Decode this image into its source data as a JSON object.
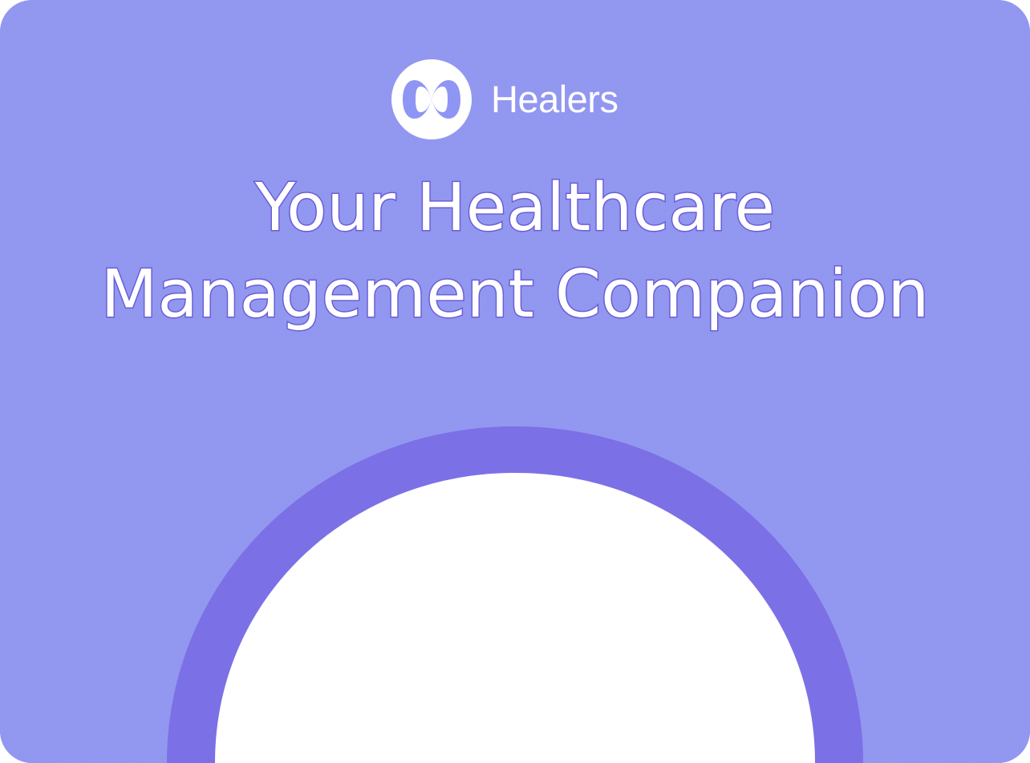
{
  "brand": {
    "name": "Healers",
    "logo_icon": "healers-logo-icon"
  },
  "hero": {
    "title_line1": "Your Healthcare",
    "title_line2": "Management Companion"
  },
  "colors": {
    "background": "#8f95f3",
    "arch": "#7c70e6",
    "title_outline": "#6a5ed6",
    "white": "#ffffff"
  }
}
